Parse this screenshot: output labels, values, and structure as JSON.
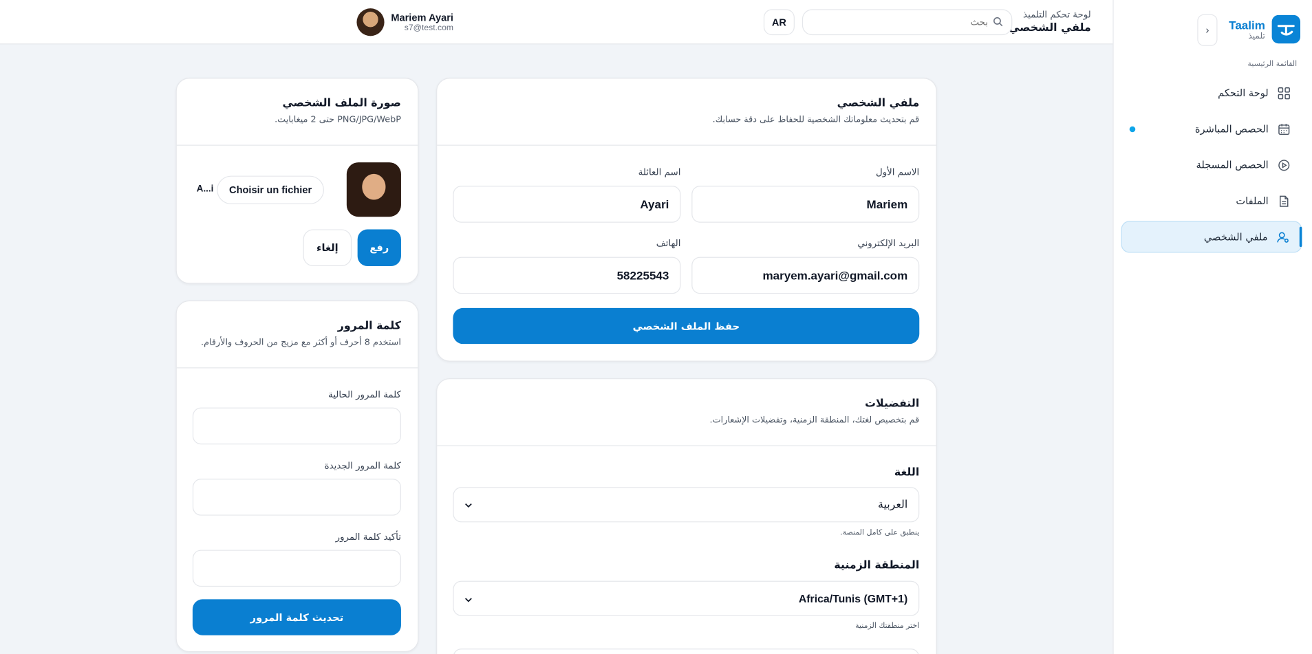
{
  "sidebar": {
    "brand_name": "Taalim",
    "brand_sub": "تلميذ",
    "logo_icon": "logo-icon",
    "collapse_glyph": "‹",
    "menu_title": "القائمة الرئيسية",
    "items": [
      {
        "label": "لوحة التحكم",
        "icon": "grid-icon"
      },
      {
        "label": "الحصص المباشرة",
        "icon": "calendar-icon",
        "live": true
      },
      {
        "label": "الحصص المسجلة",
        "icon": "play-circle-icon"
      },
      {
        "label": "الملفات",
        "icon": "file-icon"
      },
      {
        "label": "ملفي الشخصي",
        "icon": "user-icon",
        "active": true
      }
    ]
  },
  "header": {
    "breadcrumb": "لوحة تحكم التلميذ",
    "title": "ملفي الشخصي",
    "search_placeholder": "بحث",
    "lang": "AR",
    "user_name": "Mariem Ayari",
    "user_email": "s7@test.com"
  },
  "profile": {
    "title": "ملفي الشخصي",
    "desc": "قم بتحديث معلوماتك الشخصية للحفاظ على دقة حسابك.",
    "first_name_label": "الاسم الأول",
    "first_name": "Mariem",
    "last_name_label": "اسم العائلة",
    "last_name": "Ayari",
    "email_label": "البريد الإلكتروني",
    "email": "maryem.ayari@gmail.com",
    "phone_label": "الهاتف",
    "phone": "58225543",
    "save_label": "حفظ الملف الشخصي"
  },
  "photo": {
    "title": "صورة الملف الشخصي",
    "desc": "PNG/JPG/WebP حتى 2 ميغابايت.",
    "choose_file": "Choisir un fichier",
    "file_name": "A...i",
    "upload_label": "رفع",
    "cancel_label": "إلغاء"
  },
  "password": {
    "title": "كلمة المرور",
    "desc": "استخدم 8 أحرف أو أكثر مع مزيج من الحروف والأرقام.",
    "current_label": "كلمة المرور الحالية",
    "new_label": "كلمة المرور الجديدة",
    "confirm_label": "تأكيد كلمة المرور",
    "update_label": "تحديث كلمة المرور"
  },
  "preferences": {
    "title": "التفضيلات",
    "desc": "قم بتخصيص لغتك، المنطقة الزمنية، وتفضيلات الإشعارات.",
    "language_label": "اللغة",
    "language_value": "العربية",
    "language_hint": "ينطبق على كامل المنصة.",
    "timezone_label": "المنطقة الزمنية",
    "timezone_value": "Africa/Tunis (GMT+1)",
    "timezone_hint": "اختر منطقتك الزمنية"
  },
  "colors": {
    "primary": "#0a7fd1",
    "active_bg": "#e4f2fc",
    "live_dot": "#0ea5e9"
  }
}
